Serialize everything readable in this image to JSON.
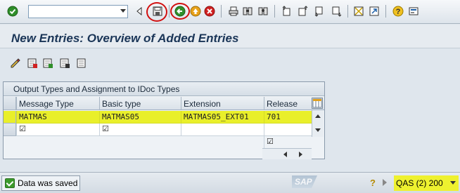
{
  "window": {
    "title": "New Entries: Overview of Added Entries"
  },
  "toolbar": {
    "command_field_value": "",
    "buttons": [
      {
        "name": "enter-icon"
      },
      {
        "name": "back-triangle-icon"
      },
      {
        "name": "save-icon"
      },
      {
        "name": "back-icon"
      },
      {
        "name": "exit-icon"
      },
      {
        "name": "cancel-icon"
      },
      {
        "name": "print-icon"
      },
      {
        "name": "find-icon"
      },
      {
        "name": "find-next-icon"
      },
      {
        "name": "first-page-icon"
      },
      {
        "name": "previous-page-icon"
      },
      {
        "name": "next-page-icon"
      },
      {
        "name": "last-page-icon"
      },
      {
        "name": "new-session-icon"
      },
      {
        "name": "shortcut-icon"
      },
      {
        "name": "help-icon"
      },
      {
        "name": "layout-icon"
      }
    ]
  },
  "app_toolbar": {
    "buttons": [
      {
        "name": "change-display-icon"
      },
      {
        "name": "new-entries-icon"
      },
      {
        "name": "copy-as-icon"
      },
      {
        "name": "delete-icon"
      },
      {
        "name": "undo-change-icon"
      }
    ]
  },
  "table": {
    "caption": "Output Types and Assignment to IDoc Types",
    "columns": [
      "Message Type",
      "Basic type",
      "Extension",
      "Release"
    ],
    "rows": [
      {
        "message_type": "MATMAS",
        "basic_type": "MATMAS05",
        "extension": "MATMAS05_EXT01",
        "release": "701",
        "highlighted": true
      },
      {
        "message_type": "☑",
        "basic_type": "☑",
        "extension": "",
        "release": "",
        "highlighted": false
      }
    ],
    "extra_row_release": "☑"
  },
  "status_bar": {
    "message": "Data was saved",
    "logo": "SAP",
    "system_info": "QAS (2) 200"
  },
  "colors": {
    "highlight": "#e9ef2a",
    "title_text": "#1a3557",
    "annotation_red": "#d21010"
  }
}
